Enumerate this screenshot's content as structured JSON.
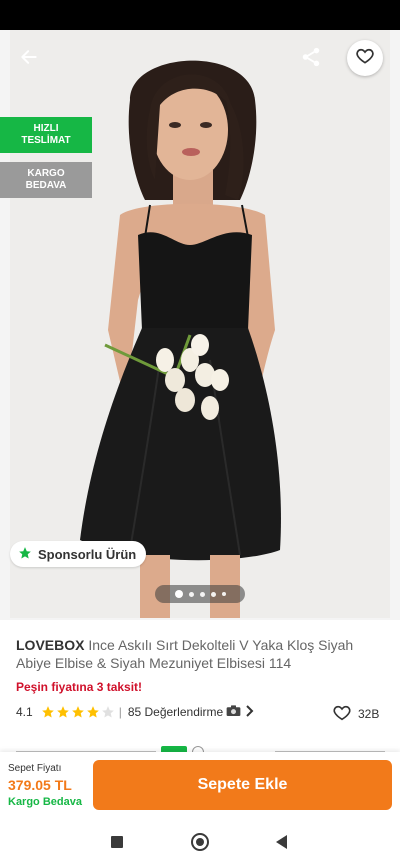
{
  "hero": {
    "badges": {
      "fast_delivery": [
        "HIZLI",
        "TESLİMAT"
      ],
      "free_cargo": [
        "KARGO",
        "BEDAVA"
      ]
    },
    "sponsored_label": "Sponsorlu Ürün",
    "carousel": {
      "total": 5,
      "active": 1
    }
  },
  "product": {
    "brand": "LOVEBOX",
    "name": "Ince Askılı Sırt Dekolteli V Yaka Kloş Siyah Abiye Elbise & Siyah Mezuniyet Elbisesi 114",
    "installment": "Peşin fiyatına 3 taksit!",
    "rating": "4.1",
    "rating_stars": 4,
    "reviews": "85 Değerlendirme",
    "likes": "32B"
  },
  "cart_bar": {
    "price_label": "Sepet Fiyatı",
    "price": "379.05 TL",
    "cargo": "Kargo Bedava",
    "button": "Sepete Ekle"
  },
  "colors": {
    "accent": "#f27a1a",
    "green": "#16b745",
    "red": "#d0112b"
  },
  "icons": [
    "back-arrow-icon",
    "share-icon",
    "heart-icon",
    "star-icon",
    "camera-icon",
    "chevron-right-icon"
  ]
}
